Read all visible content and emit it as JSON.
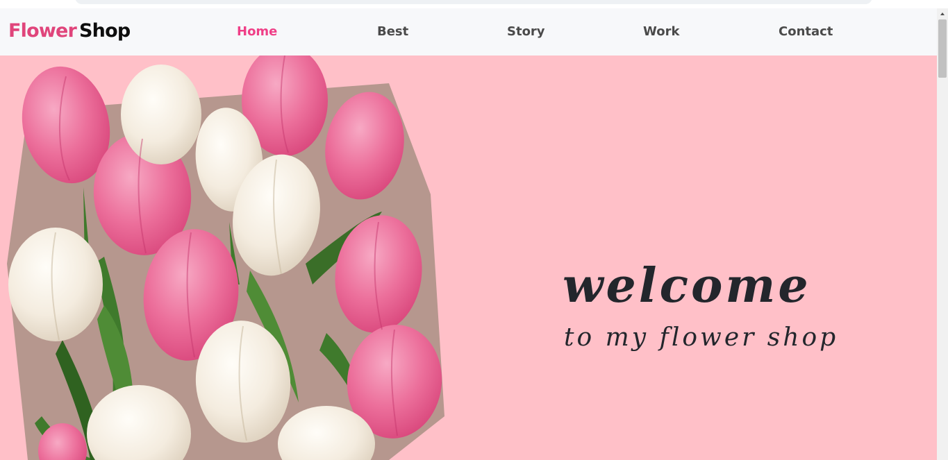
{
  "logo": {
    "part1": "Flower",
    "part2": "Shop"
  },
  "nav": {
    "items": [
      {
        "label": "Home",
        "active": true
      },
      {
        "label": "Best",
        "active": false
      },
      {
        "label": "Story",
        "active": false
      },
      {
        "label": "Work",
        "active": false
      },
      {
        "label": "Contact",
        "active": false
      }
    ]
  },
  "hero": {
    "title": "welcome",
    "subtitle": "to my flower shop",
    "image_icon": "tulip-bouquet-image"
  },
  "colors": {
    "brand_pink": "#e0457b",
    "nav_active": "#ef3f87",
    "nav_text": "#4a4a4a",
    "hero_background": "#ffc0c8",
    "navbar_background": "#f7f8fa",
    "title_text": "#23262c"
  }
}
